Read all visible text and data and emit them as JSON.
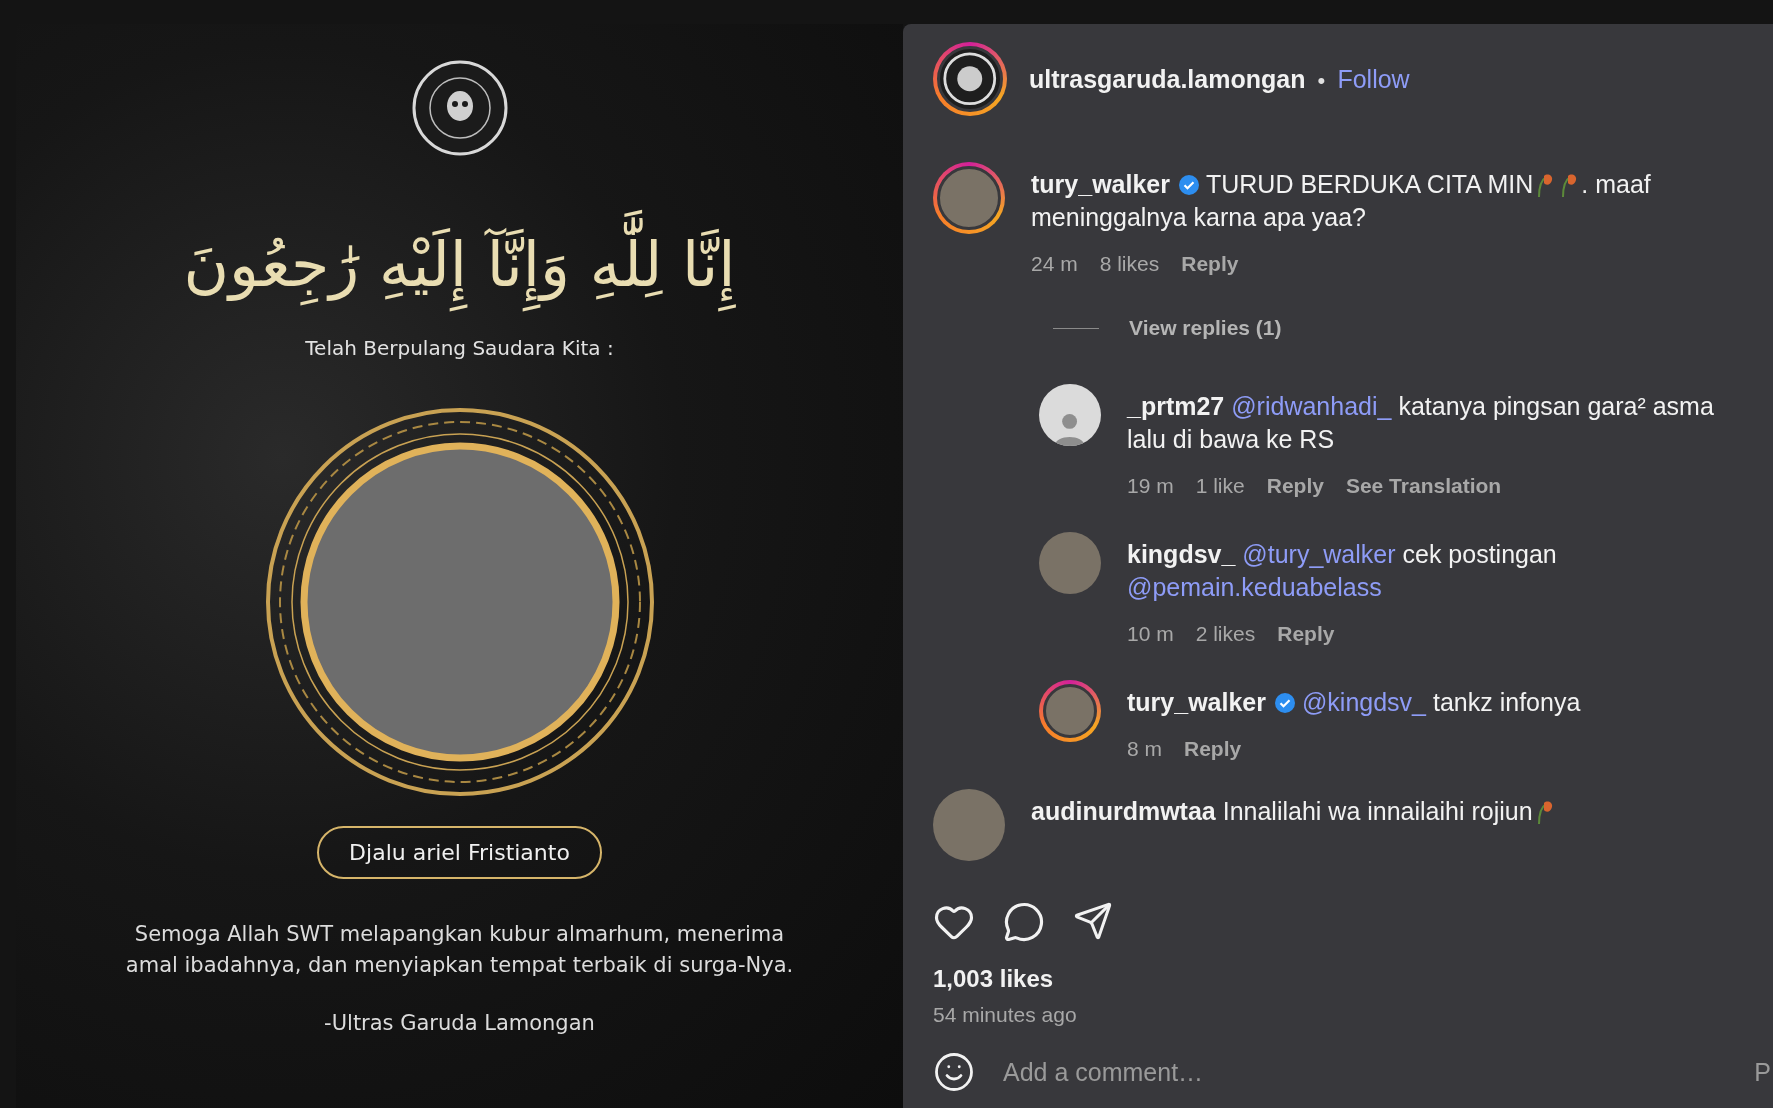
{
  "poster": {
    "arabic": "إِنَّا لِلَّٰهِ وَإِنَّآ إِلَيْهِ رَٰجِعُونَ",
    "intro": "Telah Berpulang Saudara Kita :",
    "name": "Djalu ariel Fristianto",
    "prayer": "Semoga Allah SWT melapangkan kubur almarhum, menerima amal ibadahnya, dan menyiapkan tempat terbaik di surga-Nya.",
    "signature": "-Ultras Garuda Lamongan"
  },
  "header": {
    "username": "ultrasgaruda.lamongan",
    "separator": "•",
    "follow": "Follow",
    "avatar": {
      "kind": "logo",
      "ring": true
    }
  },
  "comments": [
    {
      "username": "tury_walker",
      "verified": true,
      "avatar": {
        "kind": "photo",
        "ring": true
      },
      "segments": [
        {
          "kind": "text",
          "text": "TURUD BERDUKA CITA MIN"
        },
        {
          "kind": "emoji"
        },
        {
          "kind": "emoji"
        },
        {
          "kind": "text",
          "text": ". maaf meninggalnya karna apa yaa?"
        }
      ],
      "meta": [
        {
          "kind": "time",
          "text": "24 m"
        },
        {
          "kind": "likes",
          "text": "8 likes"
        },
        {
          "kind": "action",
          "text": "Reply"
        }
      ],
      "view_replies": "View replies (1)",
      "replies": [
        {
          "username": "_prtm27",
          "verified": false,
          "avatar": {
            "kind": "default",
            "ring": false
          },
          "segments": [
            {
              "kind": "mention",
              "text": "@ridwanhadi_"
            },
            {
              "kind": "text",
              "text": "katanya pingsan gara² asma lalu di bawa ke RS"
            }
          ],
          "meta": [
            {
              "kind": "time",
              "text": "19 m"
            },
            {
              "kind": "likes",
              "text": "1 like"
            },
            {
              "kind": "action",
              "text": "Reply"
            },
            {
              "kind": "action",
              "text": "See Translation"
            }
          ]
        },
        {
          "username": "kingdsv_",
          "verified": false,
          "avatar": {
            "kind": "photo",
            "ring": false
          },
          "segments": [
            {
              "kind": "mention",
              "text": "@tury_walker"
            },
            {
              "kind": "text",
              "text": "cek postingan"
            },
            {
              "kind": "mention",
              "text": "@pemain.keduabelass"
            }
          ],
          "meta": [
            {
              "kind": "time",
              "text": "10 m"
            },
            {
              "kind": "likes",
              "text": "2 likes"
            },
            {
              "kind": "action",
              "text": "Reply"
            }
          ]
        },
        {
          "username": "tury_walker",
          "verified": true,
          "avatar": {
            "kind": "photo",
            "ring": true
          },
          "segments": [
            {
              "kind": "mention",
              "text": "@kingdsv_"
            },
            {
              "kind": "text",
              "text": "tankz infonya"
            }
          ],
          "meta": [
            {
              "kind": "time",
              "text": "8 m"
            },
            {
              "kind": "action",
              "text": "Reply"
            }
          ]
        }
      ]
    },
    {
      "username": "audinurdmwtaa",
      "verified": false,
      "avatar": {
        "kind": "photo",
        "ring": false
      },
      "segments": [
        {
          "kind": "text",
          "text": "Innalilahi wa innailaihi rojiun"
        },
        {
          "kind": "emoji"
        }
      ]
    }
  ],
  "likes": "1,003 likes",
  "time": "54 minutes ago",
  "comment_field": {
    "placeholder": "Add a comment…"
  },
  "post_button": "P"
}
